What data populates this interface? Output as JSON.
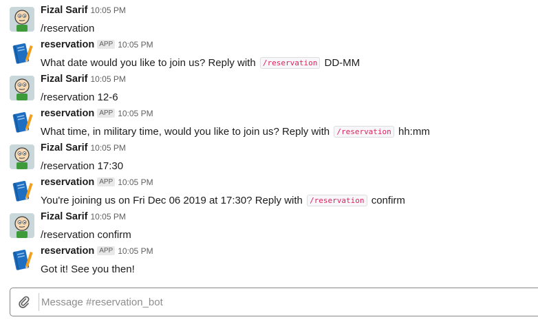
{
  "messages": [
    {
      "sender": "Fizal Sarif",
      "badge": "",
      "time": "10:05 PM",
      "avatar": "user-avatar-icon",
      "parts": [
        {
          "t": "text",
          "v": "/reservation"
        }
      ]
    },
    {
      "sender": "reservation",
      "badge": "APP",
      "time": "10:05 PM",
      "avatar": "bot-notebook-icon",
      "parts": [
        {
          "t": "text",
          "v": "What date would you like to join us? Reply with "
        },
        {
          "t": "code",
          "v": "/reservation"
        },
        {
          "t": "text",
          "v": " DD-MM"
        }
      ]
    },
    {
      "sender": "Fizal Sarif",
      "badge": "",
      "time": "10:05 PM",
      "avatar": "user-avatar-icon",
      "parts": [
        {
          "t": "text",
          "v": "/reservation 12-6"
        }
      ]
    },
    {
      "sender": "reservation",
      "badge": "APP",
      "time": "10:05 PM",
      "avatar": "bot-notebook-icon",
      "parts": [
        {
          "t": "text",
          "v": "What time, in military time, would you like to join us? Reply with "
        },
        {
          "t": "code",
          "v": "/reservation"
        },
        {
          "t": "text",
          "v": " hh:mm"
        }
      ]
    },
    {
      "sender": "Fizal Sarif",
      "badge": "",
      "time": "10:05 PM",
      "avatar": "user-avatar-icon",
      "parts": [
        {
          "t": "text",
          "v": "/reservation 17:30"
        }
      ]
    },
    {
      "sender": "reservation",
      "badge": "APP",
      "time": "10:05 PM",
      "avatar": "bot-notebook-icon",
      "parts": [
        {
          "t": "text",
          "v": "You're joining us on Fri Dec 06 2019 at 17:30? Reply with "
        },
        {
          "t": "code",
          "v": "/reservation"
        },
        {
          "t": "text",
          "v": " confirm"
        }
      ]
    },
    {
      "sender": "Fizal Sarif",
      "badge": "",
      "time": "10:05 PM",
      "avatar": "user-avatar-icon",
      "parts": [
        {
          "t": "text",
          "v": "/reservation confirm"
        }
      ]
    },
    {
      "sender": "reservation",
      "badge": "APP",
      "time": "10:05 PM",
      "avatar": "bot-notebook-icon",
      "parts": [
        {
          "t": "text",
          "v": "Got it! See you then!"
        }
      ]
    }
  ],
  "composer": {
    "placeholder": "Message #reservation_bot",
    "value": "",
    "attach_icon": "paperclip-icon"
  }
}
